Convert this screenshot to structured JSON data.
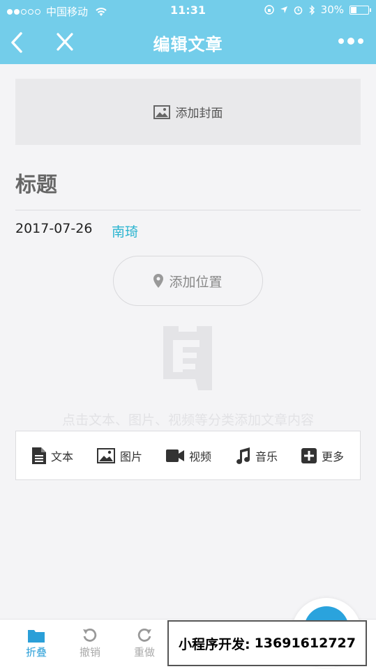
{
  "status_bar": {
    "carrier": "中国移动",
    "time": "11:31",
    "battery": "30%"
  },
  "nav": {
    "title": "编辑文章"
  },
  "cover": {
    "label": "添加封面"
  },
  "article": {
    "title_placeholder": "标题",
    "date": "2017-07-26",
    "author": "南琦"
  },
  "location": {
    "label": "添加位置"
  },
  "hint": "点击文本、图片、视频等分类添加文章内容",
  "toolbar": {
    "items": [
      {
        "label": "文本",
        "icon": "text-icon"
      },
      {
        "label": "图片",
        "icon": "image-icon"
      },
      {
        "label": "视频",
        "icon": "video-icon"
      },
      {
        "label": "音乐",
        "icon": "music-icon"
      },
      {
        "label": "更多",
        "icon": "plus-icon"
      }
    ]
  },
  "bottom": {
    "fold": "折叠",
    "undo": "撤销",
    "redo": "重做"
  },
  "promo": {
    "label": "小程序开发:",
    "phone": "13691612727"
  },
  "colors": {
    "header": "#73cdea",
    "accent": "#2bb4d0",
    "active": "#2a9fd8"
  }
}
